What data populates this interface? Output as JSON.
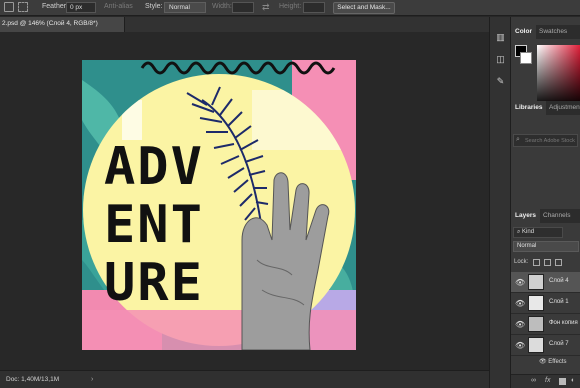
{
  "options_bar": {
    "feather_label": "Feather:",
    "feather_value": "0 px",
    "antialias_label": "Anti-alias",
    "style_label": "Style:",
    "style_value": "Normal",
    "width_label": "Width:",
    "height_label": "Height:",
    "select_mask_label": "Select and Mask..."
  },
  "document": {
    "tab_title": "2.psd @ 146% (Слой 4, RGB/8*)",
    "status_doc_size": "Doc: 1,40M/13,1M"
  },
  "artwork": {
    "word_line1": "ADV",
    "word_line2": "ENT",
    "word_line3": "URE"
  },
  "color_panel": {
    "tabs": [
      "Color",
      "Swatches"
    ]
  },
  "libraries_panel": {
    "tabs": [
      "Libraries",
      "Adjustments"
    ],
    "search_placeholder": "Search Adobe Stock"
  },
  "layers_panel": {
    "tabs": [
      "Layers",
      "Channels"
    ],
    "filter_value": "Kind",
    "blend_mode": "Normal",
    "lock_label": "Lock:",
    "layers": [
      {
        "name": "Слой 4",
        "selected": true
      },
      {
        "name": "Слой 1",
        "selected": false
      },
      {
        "name": "Фон копия",
        "selected": false
      },
      {
        "name": "Слой 7",
        "selected": false
      }
    ],
    "effects_label": "Effects",
    "footer_fx": "fx"
  },
  "colors": {
    "ui_dark": "#282828",
    "panel": "#3a3a3a",
    "art_teal": "#2f8f8c",
    "art_yellow": "#fbf4a4",
    "art_pink": "#f58fb5",
    "art_blue": "#1d2a6a"
  },
  "icons": [
    "rect-select-icon",
    "arrange-icon",
    "swap-icon",
    "color-picker-icon",
    "search-icon",
    "eye-icon",
    "fx-icon",
    "trash-icon"
  ]
}
